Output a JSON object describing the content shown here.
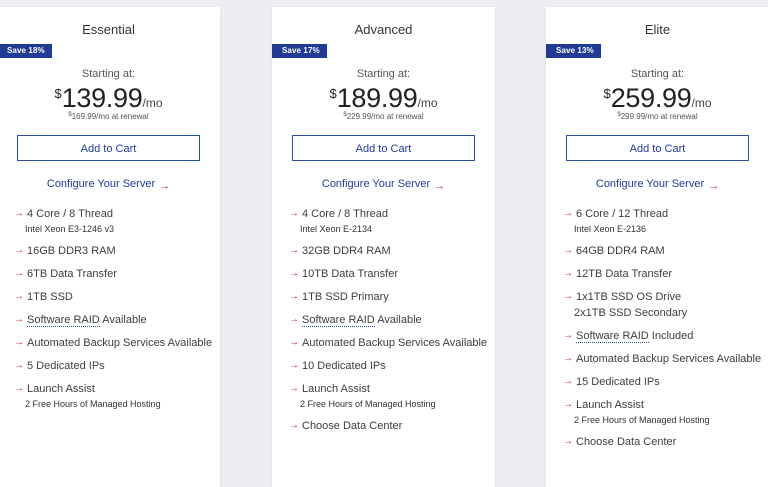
{
  "plans": [
    {
      "name": "Essential",
      "badge": "Save 18%",
      "starting_label": "Starting at:",
      "currency": "$",
      "price": "139.99",
      "per": "/mo",
      "renewal_currency": "$",
      "renewal_price": "169.99/mo at renewal",
      "cart_label": "Add to Cart",
      "configure_label": "Configure Your Server",
      "features": {
        "cpu": "4 Core / 8 Thread",
        "cpu_model": "Intel Xeon E3-1246 v3",
        "ram": "16GB DDR3 RAM",
        "transfer": "6TB Data Transfer",
        "ssd": "1TB SSD",
        "raid_link": "Software RAID",
        "raid_rest": " Available",
        "backup": "Automated Backup Services Available",
        "ips": "5 Dedicated IPs",
        "launch": "Launch Assist",
        "launch_sub": "2 Free Hours of Managed Hosting"
      }
    },
    {
      "name": "Advanced",
      "badge": "Save 17%",
      "starting_label": "Starting at:",
      "currency": "$",
      "price": "189.99",
      "per": "/mo",
      "renewal_currency": "$",
      "renewal_price": "229.99/mo at renewal",
      "cart_label": "Add to Cart",
      "configure_label": "Configure Your Server",
      "features": {
        "cpu": "4 Core / 8 Thread",
        "cpu_model": "Intel Xeon E-2134",
        "ram": "32GB DDR4 RAM",
        "transfer": "10TB Data Transfer",
        "ssd": "1TB SSD Primary",
        "raid_link": "Software RAID",
        "raid_rest": " Available",
        "backup": "Automated Backup Services Available",
        "ips": "10 Dedicated IPs",
        "launch": "Launch Assist",
        "launch_sub": "2 Free Hours of Managed Hosting",
        "datacenter": "Choose Data Center"
      }
    },
    {
      "name": "Elite",
      "badge": "Save 13%",
      "starting_label": "Starting at:",
      "currency": "$",
      "price": "259.99",
      "per": "/mo",
      "renewal_currency": "$",
      "renewal_price": "299.99/mo at renewal",
      "cart_label": "Add to Cart",
      "configure_label": "Configure Your Server",
      "features": {
        "cpu": "6 Core / 12 Thread",
        "cpu_model": "Intel Xeon E-2136",
        "ram": "64GB DDR4 RAM",
        "transfer": "12TB Data Transfer",
        "ssd": "1x1TB SSD OS Drive",
        "ssd_sub": "2x1TB SSD Secondary",
        "raid_link": "Software RAID",
        "raid_rest": " Included",
        "backup": "Automated Backup Services Available",
        "ips": "15 Dedicated IPs",
        "launch": "Launch Assist",
        "launch_sub": "2 Free Hours of Managed Hosting",
        "datacenter": "Choose Data Center"
      }
    }
  ],
  "icons": {
    "bullet": "arrow-right-icon",
    "configure_arrow": "arrow-right-icon"
  },
  "colors": {
    "accent": "#1e3c9c",
    "badge": "#1f3b94",
    "bullet": "#c8263c"
  }
}
